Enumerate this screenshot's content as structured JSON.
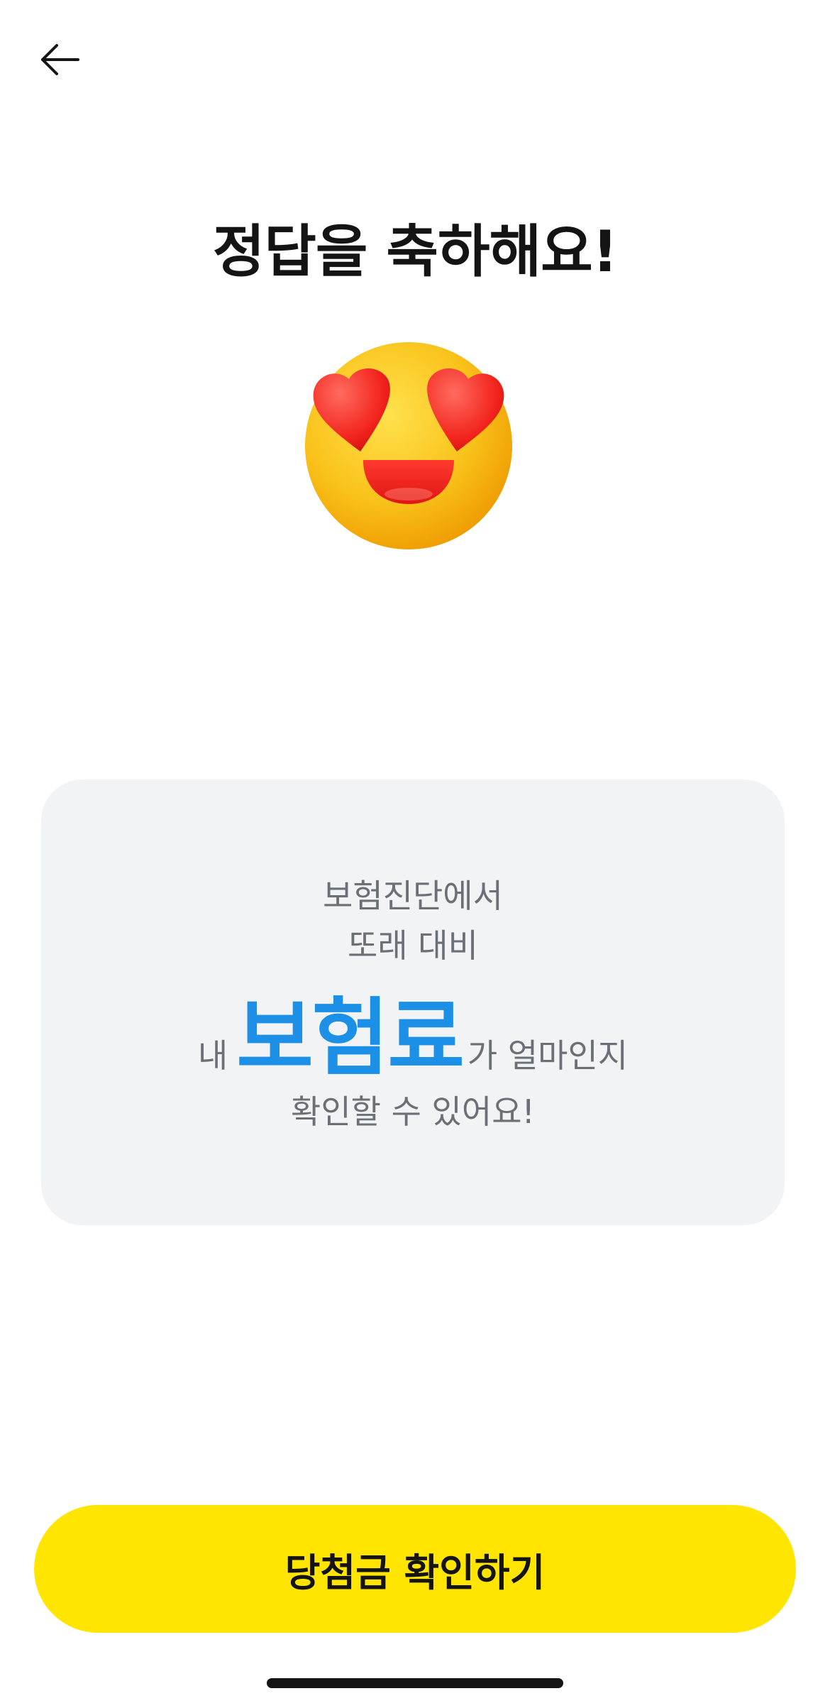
{
  "header": {
    "back_icon": "arrow-left-icon"
  },
  "title": "정답을 축하해요!",
  "emoji": {
    "icon": "heart-eyes-emoji",
    "face_color": "#f7b500",
    "heart_color": "#ff3b30"
  },
  "card": {
    "line1": "보험진단에서",
    "line2": "또래 대비",
    "line3_prefix": "내",
    "line3_highlight": "보험료",
    "line3_suffix": "가 얼마인지",
    "line4": "확인할 수 있어요!",
    "highlight_color": "#1c8fe6",
    "background": "#f2f3f5"
  },
  "cta": {
    "label": "당첨금 확인하기",
    "color": "#ffe500"
  }
}
